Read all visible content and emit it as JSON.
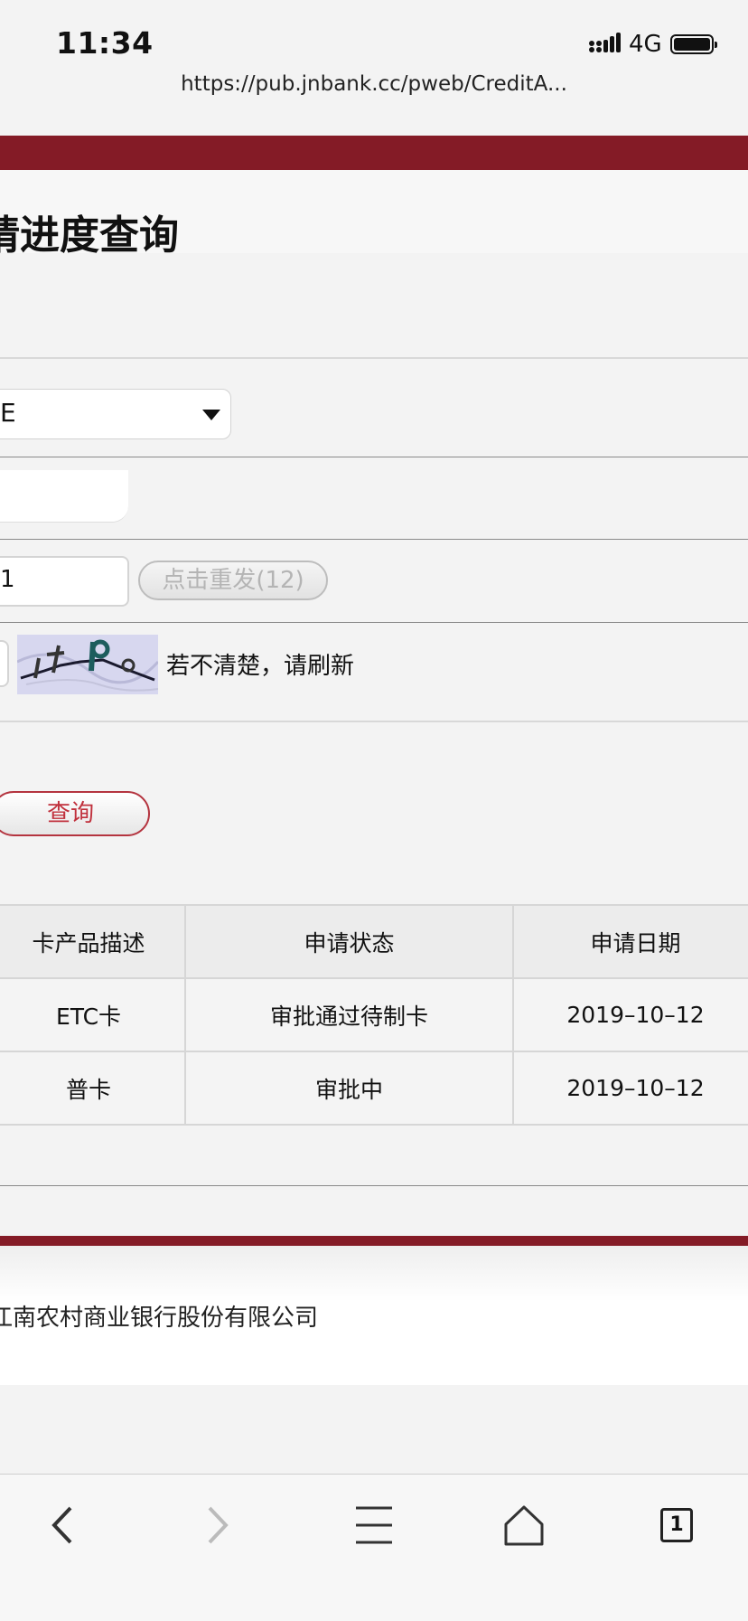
{
  "status_bar": {
    "time": "11:34",
    "network": "4G",
    "signal_icon": "cellular-signal-icon",
    "battery_icon": "battery-icon"
  },
  "browser": {
    "url": "https://pub.jnbank.cc/pweb/CreditA...",
    "tab_count": "1",
    "toolbar_icons": [
      "back-icon",
      "forward-icon",
      "menu-icon",
      "home-icon",
      "tabs-icon"
    ]
  },
  "page": {
    "title": "请进度查询",
    "accent_color": "#841b26"
  },
  "form": {
    "id_type_value": "E",
    "sms_code_value": "1",
    "resend_button_label": "点击重发(12)",
    "captcha_hint": "若不清楚，请刷新",
    "query_button_label": "查询"
  },
  "results": {
    "headers": [
      "卡产品描述",
      "申请状态",
      "申请日期"
    ],
    "rows": [
      [
        "ETC卡",
        "审批通过待制卡",
        "2019–10–12"
      ],
      [
        "普卡",
        "审批中",
        "2019–10–12"
      ]
    ]
  },
  "footer": {
    "company": "江南农村商业银行股份有限公司"
  }
}
